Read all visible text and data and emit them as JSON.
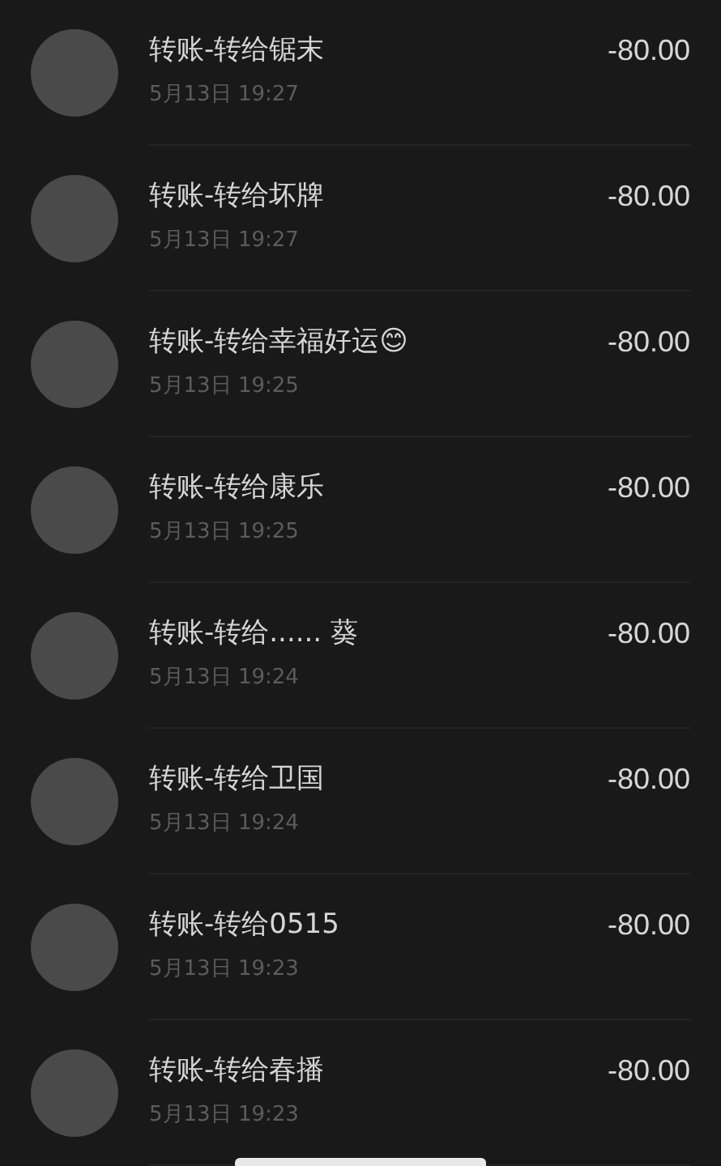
{
  "transactions": [
    {
      "title": "转账-转给锯末",
      "time": "5月13日 19:27",
      "amount": "-80.00"
    },
    {
      "title": "转账-转给坏牌",
      "time": "5月13日 19:27",
      "amount": "-80.00"
    },
    {
      "title": "转账-转给幸福好运😊",
      "time": "5月13日 19:25",
      "amount": "-80.00"
    },
    {
      "title": "转账-转给康乐",
      "time": "5月13日 19:25",
      "amount": "-80.00"
    },
    {
      "title": "转账-转给...... 葵",
      "time": "5月13日 19:24",
      "amount": "-80.00"
    },
    {
      "title": "转账-转给卫国",
      "time": "5月13日 19:24",
      "amount": "-80.00"
    },
    {
      "title": "转账-转给0515",
      "time": "5月13日 19:23",
      "amount": "-80.00"
    },
    {
      "title": "转账-转给春播",
      "time": "5月13日 19:23",
      "amount": "-80.00"
    }
  ]
}
